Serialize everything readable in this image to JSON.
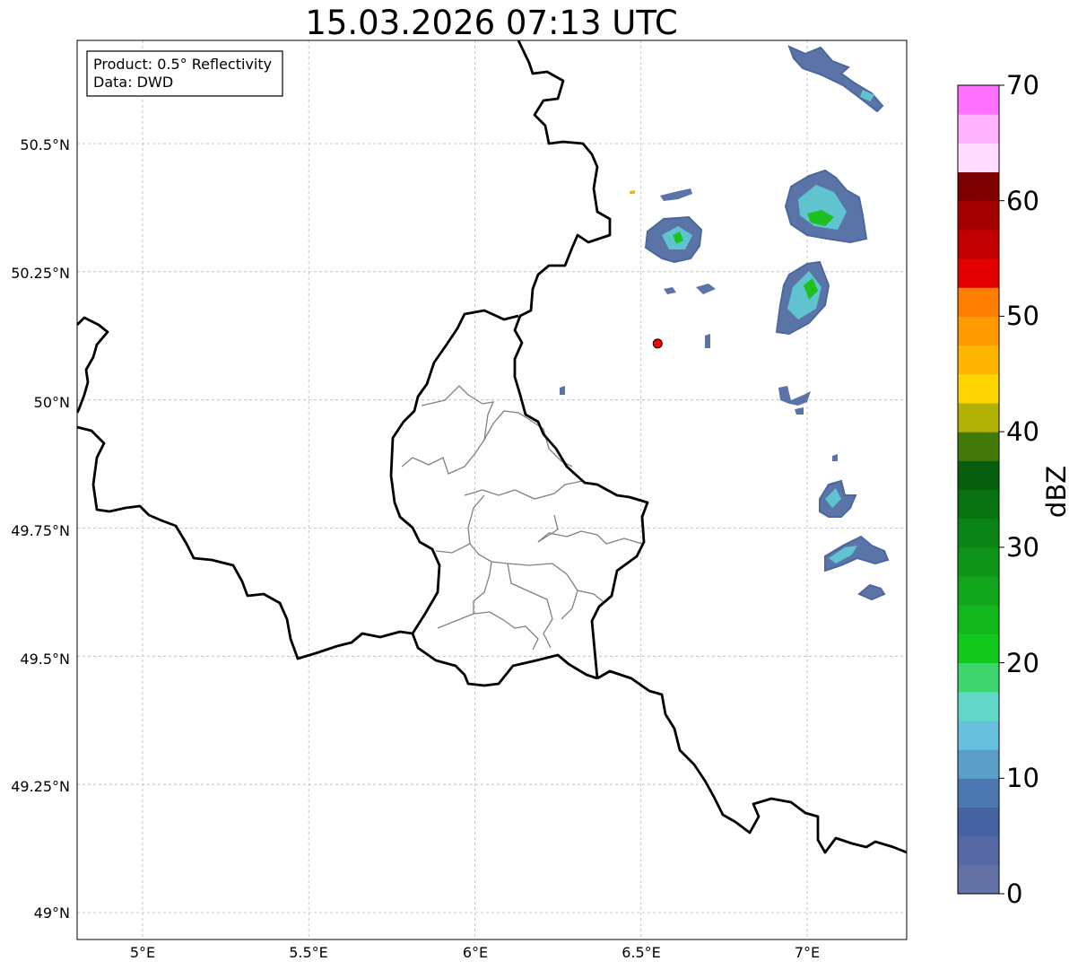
{
  "title": "15.03.2026 07:13 UTC",
  "info_box": {
    "product": "Product: 0.5° Reflectivity",
    "data": "Data: DWD"
  },
  "axes": {
    "lon_ticks": [
      "5°E",
      "5.5°E",
      "6°E",
      "6.5°E",
      "7°E"
    ],
    "lat_ticks": [
      "50.5°N",
      "50.25°N",
      "50°N",
      "49.75°N",
      "49.5°N",
      "49.25°N",
      "49°N"
    ],
    "gridlines": "dashed light grey",
    "lon_range": [
      4.8,
      7.3
    ],
    "lat_range": [
      48.95,
      50.7
    ]
  },
  "colorbar": {
    "label": "dBZ",
    "ticks": [
      "0",
      "10",
      "20",
      "30",
      "40",
      "50",
      "60",
      "70"
    ],
    "range": [
      0,
      70
    ],
    "step": 2.5,
    "colors": [
      "#6471a5",
      "#5568a3",
      "#4762a3",
      "#4b78b1",
      "#5b9ec8",
      "#67c0dc",
      "#63d7c8",
      "#3fd670",
      "#12c91d",
      "#11b71b",
      "#10a51a",
      "#0e9418",
      "#0b8417",
      "#097312",
      "#075f0d",
      "#457a0a",
      "#b1b106",
      "#ffd500",
      "#ffb600",
      "#ff9a00",
      "#ff7d00",
      "#e30000",
      "#c20000",
      "#a40000",
      "#7f0000",
      "#ffdcff",
      "#ffb2ff",
      "#ff72ff",
      "#ec3ced"
    ]
  },
  "radar_site": {
    "lon": 6.55,
    "lat": 50.11,
    "color": "#ff0000"
  },
  "borders": {
    "national_color": "#000000",
    "district_color": "#808080"
  },
  "echoes": [
    {
      "lon": 7.07,
      "lat": 50.62,
      "dbz_max": 15
    },
    {
      "lon": 6.61,
      "lat": 50.32,
      "dbz_max": 20
    },
    {
      "lon": 7.05,
      "lat": 50.37,
      "dbz_max": 28
    },
    {
      "lon": 7.0,
      "lat": 50.21,
      "dbz_max": 25
    },
    {
      "lon": 7.08,
      "lat": 49.8,
      "dbz_max": 15
    },
    {
      "lon": 7.13,
      "lat": 49.7,
      "dbz_max": 17
    }
  ]
}
